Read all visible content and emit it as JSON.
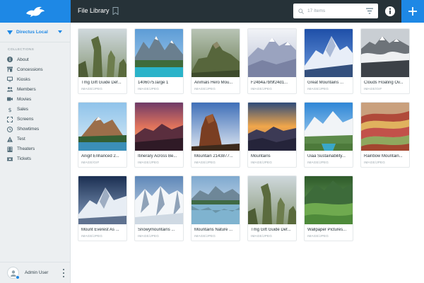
{
  "sidebar": {
    "project_name": "Directus Local",
    "section_title": "COLLECTIONS",
    "items": [
      {
        "label": "About",
        "icon": "info-icon"
      },
      {
        "label": "Concessions",
        "icon": "store-icon"
      },
      {
        "label": "Kiosks",
        "icon": "monitor-icon"
      },
      {
        "label": "Members",
        "icon": "people-icon"
      },
      {
        "label": "Movies",
        "icon": "film-icon"
      },
      {
        "label": "Sales",
        "icon": "dollar-icon"
      },
      {
        "label": "Screens",
        "icon": "screen-icon"
      },
      {
        "label": "Showtimes",
        "icon": "clock-icon"
      },
      {
        "label": "Test",
        "icon": "warning-icon"
      },
      {
        "label": "Theaters",
        "icon": "building-icon"
      },
      {
        "label": "Tickets",
        "icon": "ticket-icon"
      }
    ],
    "user_name": "Admin User"
  },
  "header": {
    "title": "File Library",
    "search_placeholder": "17 Items"
  },
  "colors": {
    "accent": "#1e88e5",
    "header_bg": "#263238",
    "sidebar_bg": "#eceff1"
  },
  "files": [
    {
      "title": "Tmg Gift Guide Def...",
      "type": "IMAGE/JPEG"
    },
    {
      "title": "1406075.large 1",
      "type": "IMAGE/JPEG"
    },
    {
      "title": "Animals Hero Mou...",
      "type": "IMAGE/JPEG"
    },
    {
      "title": "F24b4a7bf9f24d1...",
      "type": "IMAGE/JPEG"
    },
    {
      "title": "Great Mountains ...",
      "type": "IMAGE/JPEG"
    },
    {
      "title": "Clouds Floating Ov...",
      "type": "IMAGE/GIF"
    },
    {
      "title": "Anigif Enhanced 2...",
      "type": "IMAGE/GIF"
    },
    {
      "title": "Itinerary Across Be...",
      "type": "IMAGE/JPEG"
    },
    {
      "title": "Mountain 2143877...",
      "type": "IMAGE/JPEG"
    },
    {
      "title": "Mountains",
      "type": "IMAGE/JPEG"
    },
    {
      "title": "Uiaa Sustainability...",
      "type": "IMAGE/JPEG"
    },
    {
      "title": "Rainbow Mountain...",
      "type": "IMAGE/JPEG"
    },
    {
      "title": "Mount Everest As ...",
      "type": "IMAGE/JPEG"
    },
    {
      "title": "Snowymountains ...",
      "type": "IMAGE/JPEG"
    },
    {
      "title": "Mountains Nature ...",
      "type": "IMAGE/JPEG"
    },
    {
      "title": "Tmg Gift Guide Def...",
      "type": "IMAGE/JPEG"
    },
    {
      "title": "Wallpaper Pictures...",
      "type": "IMAGE/JPEG"
    }
  ]
}
